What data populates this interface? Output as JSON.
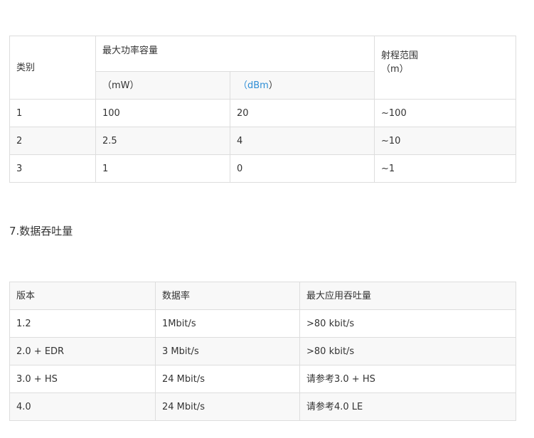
{
  "table1": {
    "header": {
      "category": "类别",
      "max_power": "最大功率容量",
      "unit_mw": "（mW）",
      "unit_dbm_open": "（",
      "unit_dbm_text": "dBm",
      "unit_dbm_close": "）",
      "range_label": "射程范围",
      "range_unit": "（m）"
    },
    "rows": [
      [
        "1",
        "100",
        "20",
        "~100"
      ],
      [
        "2",
        "2.5",
        "4",
        "~10"
      ],
      [
        "3",
        "1",
        "0",
        "~1"
      ]
    ]
  },
  "section_title": "7.数据吞吐量",
  "table2": {
    "headers": [
      "版本",
      "数据率",
      "最大应用吞吐量"
    ],
    "rows": [
      [
        "1.2",
        "1Mbit/s",
        ">80 kbit/s"
      ],
      [
        "2.0 + EDR",
        "3 Mbit/s",
        ">80 kbit/s"
      ],
      [
        "3.0 + HS",
        "24 Mbit/s",
        "请参考3.0 + HS"
      ],
      [
        "4.0",
        "24 Mbit/s",
        "请参考4.0 LE"
      ]
    ]
  },
  "colors": {
    "link": "#2e8ed6",
    "stripe": "#f8f8f8",
    "border": "#dddddd"
  }
}
